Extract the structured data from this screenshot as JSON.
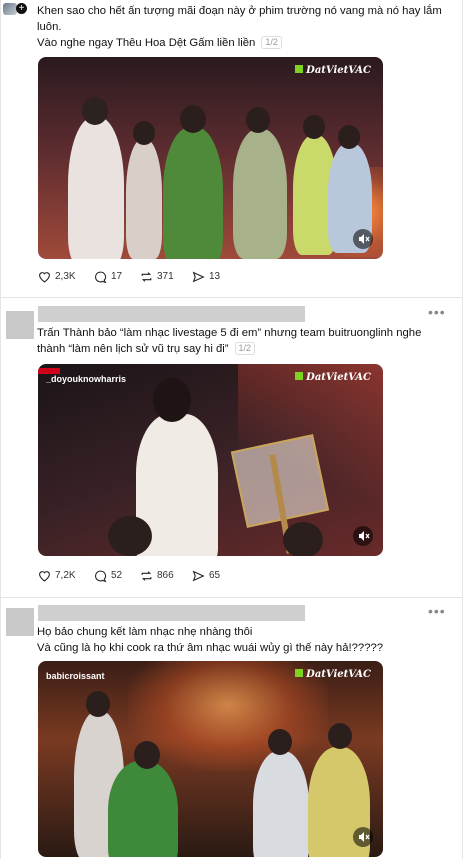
{
  "posts": [
    {
      "text_lines": [
        "Khen sao cho hết ấn tượng mãi đoạn này ở phim trường nó vang mà nó hay lắm luôn.",
        "Vào nghe ngay Thêu Hoa Dệt Gấm liền liền"
      ],
      "pager": "1/2",
      "media": {
        "watermark": "DatVietVAC",
        "handle": ""
      },
      "stats": {
        "likes": "2,3K",
        "comments": "17",
        "reposts": "371",
        "shares": "13"
      }
    },
    {
      "text_lines": [
        "Trấn Thành bảo “làm nhạc livestage 5 đi em” nhưng team buitruonglinh nghe thành “làm nên lịch sử vũ trụ say hi đi”"
      ],
      "pager": "1/2",
      "media": {
        "watermark": "DatVietVAC",
        "handle": "_doyouknowharris"
      },
      "stats": {
        "likes": "7,2K",
        "comments": "52",
        "reposts": "866",
        "shares": "65"
      }
    },
    {
      "text_lines": [
        "Họ bảo chung kết làm nhạc nhẹ nhàng thôi",
        "Và cũng là họ khi cook ra thứ âm nhạc wuái wủy gì thế này hả!?????"
      ],
      "pager": "",
      "media": {
        "watermark": "DatVietVAC",
        "handle": "babicroissant"
      },
      "stats": null
    }
  ],
  "colors": {
    "accent_green": "#7ed321",
    "muted": "#999999"
  }
}
